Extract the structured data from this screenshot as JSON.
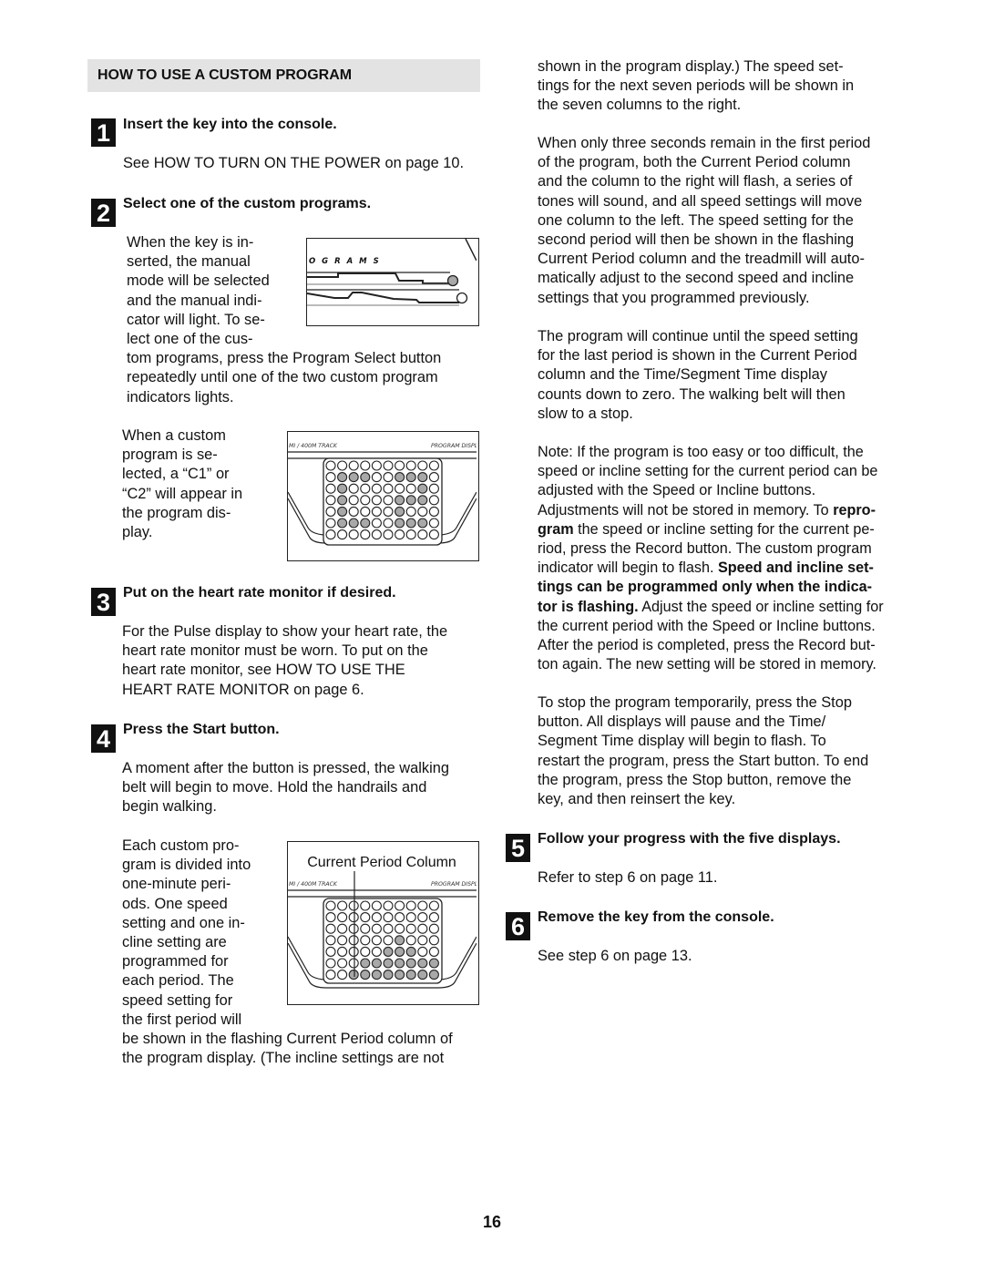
{
  "section_title": "HOW TO USE A CUSTOM PROGRAM",
  "steps": [
    {
      "number": "1",
      "heading": "Insert the key into the console.",
      "body": "See HOW TO TURN ON THE POWER on page 10."
    },
    {
      "number": "2",
      "heading": "Select one of the custom programs."
    },
    {
      "number": "3",
      "heading": "Put on the heart rate monitor if desired."
    },
    {
      "number": "4",
      "heading": "Press the Start button."
    },
    {
      "number": "5",
      "heading": "Follow your progress with the five displays.",
      "body": "Refer to step 6 on page 11."
    },
    {
      "number": "6",
      "heading": "Remove the key from the console.",
      "body": "See step 6 on page 13."
    }
  ],
  "step2": {
    "wrap_lines": [
      "When the key is in-",
      "serted, the manual",
      "mode will be selected",
      "and the manual indi-",
      "cator will light. To se-",
      "lect one of the cus-"
    ],
    "full_lines": [
      "tom programs, press the Program Select button",
      "repeatedly until one of the two custom program",
      "indicators lights."
    ],
    "c_lines": [
      "When a custom",
      "program is se-",
      "lected, a “C1” or",
      "“C2” will appear in",
      "the program dis-",
      "play."
    ]
  },
  "step3": {
    "lines": [
      "For the Pulse display to show your heart rate, the",
      "heart rate monitor must be worn. To put on the",
      "heart rate monitor, see HOW TO USE THE",
      "HEART RATE MONITOR on page 6."
    ]
  },
  "step4": {
    "lines": [
      "A moment after the button is pressed, the walking",
      "belt will begin to move. Hold the handrails and",
      "begin walking."
    ],
    "wrap_lines": [
      "Each custom pro-",
      "gram is divided into",
      "one-minute peri-",
      "ods. One speed",
      "setting and one in-",
      "cline setting are",
      "programmed for",
      "each period. The",
      "speed setting for",
      "the first period will"
    ],
    "full_lines": [
      "be shown in the flashing Current Period column of",
      "the program display. (The incline settings are not"
    ]
  },
  "right_column": {
    "p1": [
      "shown in the program display.) The speed set-",
      "tings for the next seven periods will be shown in",
      "the seven columns to the right."
    ],
    "p2": [
      "When only three seconds remain in the first period",
      "of the program, both the Current Period column",
      "and the column to the right will flash, a series of",
      "tones will sound, and all speed settings will move",
      "one column to the left. The speed setting for the",
      "second period will then be shown in the flashing",
      "Current Period column and the treadmill will auto-",
      "matically adjust to the second speed and incline",
      "settings that you programmed previously."
    ],
    "p3": [
      "The program will continue until the speed setting",
      "for the last period is shown in the Current Period",
      "column and the Time/Segment Time display",
      "counts down to zero. The walking belt will then",
      "slow to a stop."
    ],
    "note": {
      "l1": "Note: If the program is too easy or too difficult, the",
      "l2": "speed or incline setting for the current period can be",
      "l3": "adjusted with the Speed or Incline buttons.",
      "l4a": "Adjustments will not be stored in memory. To ",
      "l4b": "repro-",
      "l5a": "gram",
      "l5b": " the speed or incline setting for the current pe-",
      "l6": "riod, press the Record button. The custom program",
      "l7a": "indicator will begin to flash. ",
      "l7b": "Speed and incline set-",
      "l8": "tings can be programmed only when the indica-",
      "l9a": "tor is flashing.",
      "l9b": " Adjust the speed or incline setting for",
      "l10": "the current period with the Speed or Incline buttons.",
      "l11": "After the period is completed, press the Record but-",
      "l12": "ton again. The new setting will be stored in memory."
    },
    "p5": [
      "To stop the program temporarily, press the Stop",
      "button. All displays will pause and the Time/",
      "Segment Time display will begin to flash. To",
      "restart the program, press the Start button. To end",
      "the program, press the Stop button, remove the",
      "key, and then reinsert the key."
    ]
  },
  "figures": {
    "programs_label": "O G R A M S",
    "track_label": "MI  /  400M TRACK",
    "program_display_label": "PROGRAM DISPL",
    "current_period_label": "Current Period Column",
    "c1_matrix": [
      "0000000000",
      "0111001110",
      "0100000010",
      "0100001110",
      "0100001000",
      "0111001110",
      "0000000000"
    ],
    "period_matrix": [
      "0000000000",
      "0000000000",
      "0000000000",
      "0000001000",
      "0000011100",
      "0001111111",
      "0011111111"
    ],
    "colors": {
      "lit": "#a8a8a8",
      "unlit": "#ffffff",
      "stroke": "#222222"
    }
  },
  "page_number": "16"
}
